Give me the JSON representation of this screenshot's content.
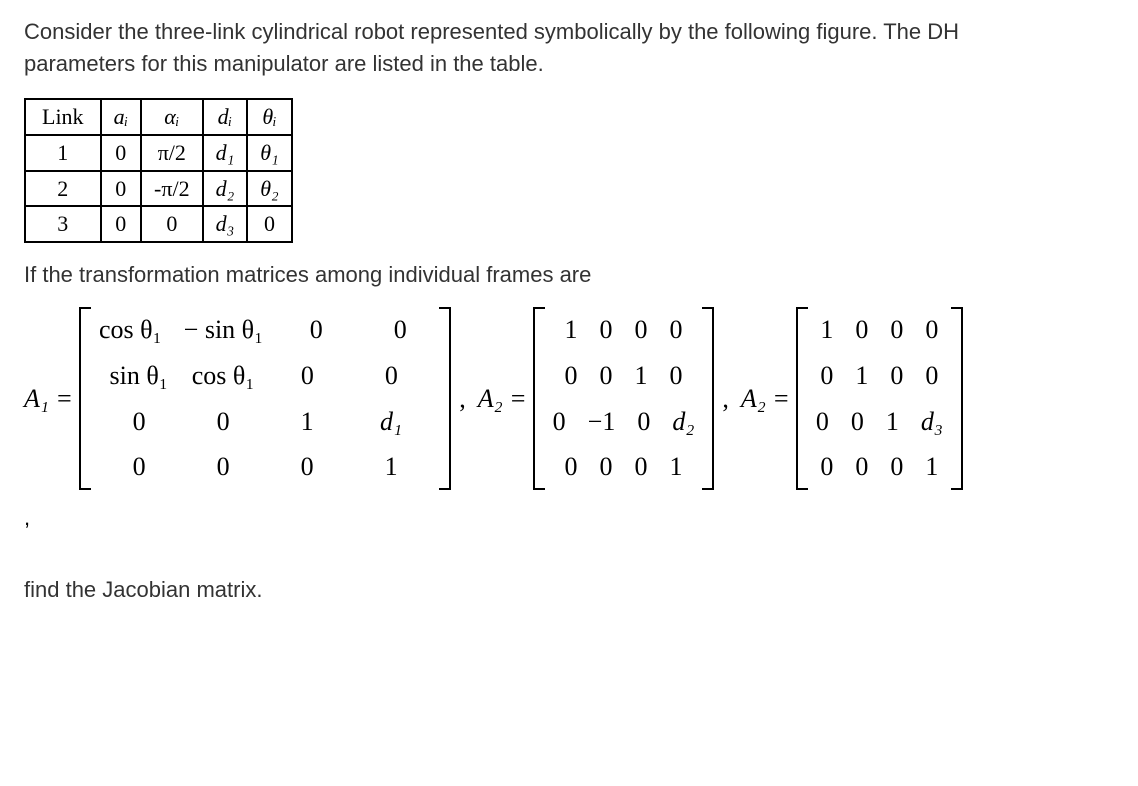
{
  "intro": "Consider the three-link cylindrical robot represented symbolically by the following figure. The DH parameters for this manipulator are listed in the table.",
  "trans_line": "If the transformation matrices among individual frames are",
  "final_line": "find the Jacobian matrix.",
  "lone_comma": ",",
  "dh_table": {
    "headers": [
      "Link",
      "aᵢ",
      "αᵢ",
      "dᵢ",
      "θᵢ"
    ],
    "rows": [
      [
        "1",
        "0",
        "π/2",
        "d₁",
        "θ₁"
      ],
      [
        "2",
        "0",
        "-π/2",
        "d₂",
        "θ₂"
      ],
      [
        "3",
        "0",
        "0",
        "d₃",
        "0"
      ]
    ]
  },
  "matrices": {
    "A1": {
      "label": "A₁ =",
      "rows": [
        [
          "cos θ₁",
          "− sin θ₁",
          "0",
          "0"
        ],
        [
          "sin θ₁",
          "cos θ₁",
          "0",
          "0"
        ],
        [
          "0",
          "0",
          "1",
          "d₁"
        ],
        [
          "0",
          "0",
          "0",
          "1"
        ]
      ]
    },
    "sep1": ",",
    "A2": {
      "label": "A₂ =",
      "rows": [
        [
          "1",
          "0",
          "0",
          "0"
        ],
        [
          "0",
          "0",
          "1",
          "0"
        ],
        [
          "0",
          "−1",
          "0",
          "d₂"
        ],
        [
          "0",
          "0",
          "0",
          "1"
        ]
      ]
    },
    "sep2": ",",
    "A3": {
      "label": "A₂ =",
      "rows": [
        [
          "1",
          "0",
          "0",
          "0"
        ],
        [
          "0",
          "1",
          "0",
          "0"
        ],
        [
          "0",
          "0",
          "1",
          "d₃"
        ],
        [
          "0",
          "0",
          "0",
          "1"
        ]
      ]
    }
  }
}
